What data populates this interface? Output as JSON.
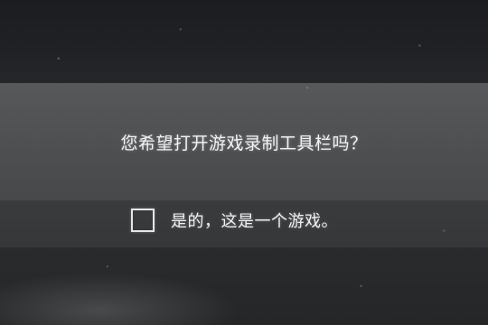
{
  "dialog": {
    "prompt": "您希望打开游戏录制工具栏吗？",
    "checkbox_label": "是的，这是一个游戏。",
    "checkbox_checked": false
  },
  "colors": {
    "panel": "#505254",
    "text": "#f2f2f2",
    "background": "#1b1c1e"
  }
}
